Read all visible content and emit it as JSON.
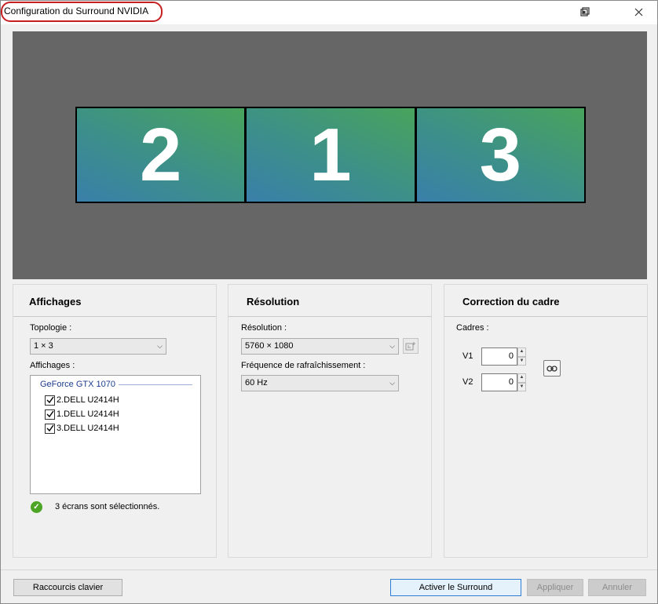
{
  "window": {
    "title": "Configuration du Surround NVIDIA"
  },
  "preview": {
    "monitors": [
      "2",
      "1",
      "3"
    ]
  },
  "panels": {
    "displays": {
      "title": "Affichages",
      "topology_label": "Topologie :",
      "topology_value": "1 × 3",
      "displays_label": "Affichages :",
      "gpu_name": "GeForce GTX 1070",
      "items": [
        {
          "label": "2.DELL U2414H",
          "checked": true
        },
        {
          "label": "1.DELL U2414H",
          "checked": true
        },
        {
          "label": "3.DELL U2414H",
          "checked": true
        }
      ],
      "status_text": "3 écrans sont sélectionnés."
    },
    "resolution": {
      "title": "Résolution",
      "resolution_label": "Résolution :",
      "resolution_value": "5760 × 1080",
      "refresh_label": "Fréquence de rafraîchissement :",
      "refresh_value": "60 Hz"
    },
    "bezel": {
      "title": "Correction du cadre",
      "frames_label": "Cadres :",
      "v1_label": "V1",
      "v1_value": "0",
      "v2_label": "V2",
      "v2_value": "0"
    }
  },
  "footer": {
    "shortcuts_label": "Raccourcis clavier",
    "activate_label": "Activer le Surround",
    "apply_label": "Appliquer",
    "cancel_label": "Annuler"
  },
  "colors": {
    "title_highlight": "#c62020",
    "gpu_header": "#1e3d8f",
    "status_ok": "#4ca524",
    "preview_bg": "#666666"
  },
  "icons": {
    "restore": "restore-window-icon",
    "close": "close-icon",
    "check": "check-icon",
    "link": "chain-link-icon",
    "custom_resolution": "custom-resolution-icon"
  }
}
